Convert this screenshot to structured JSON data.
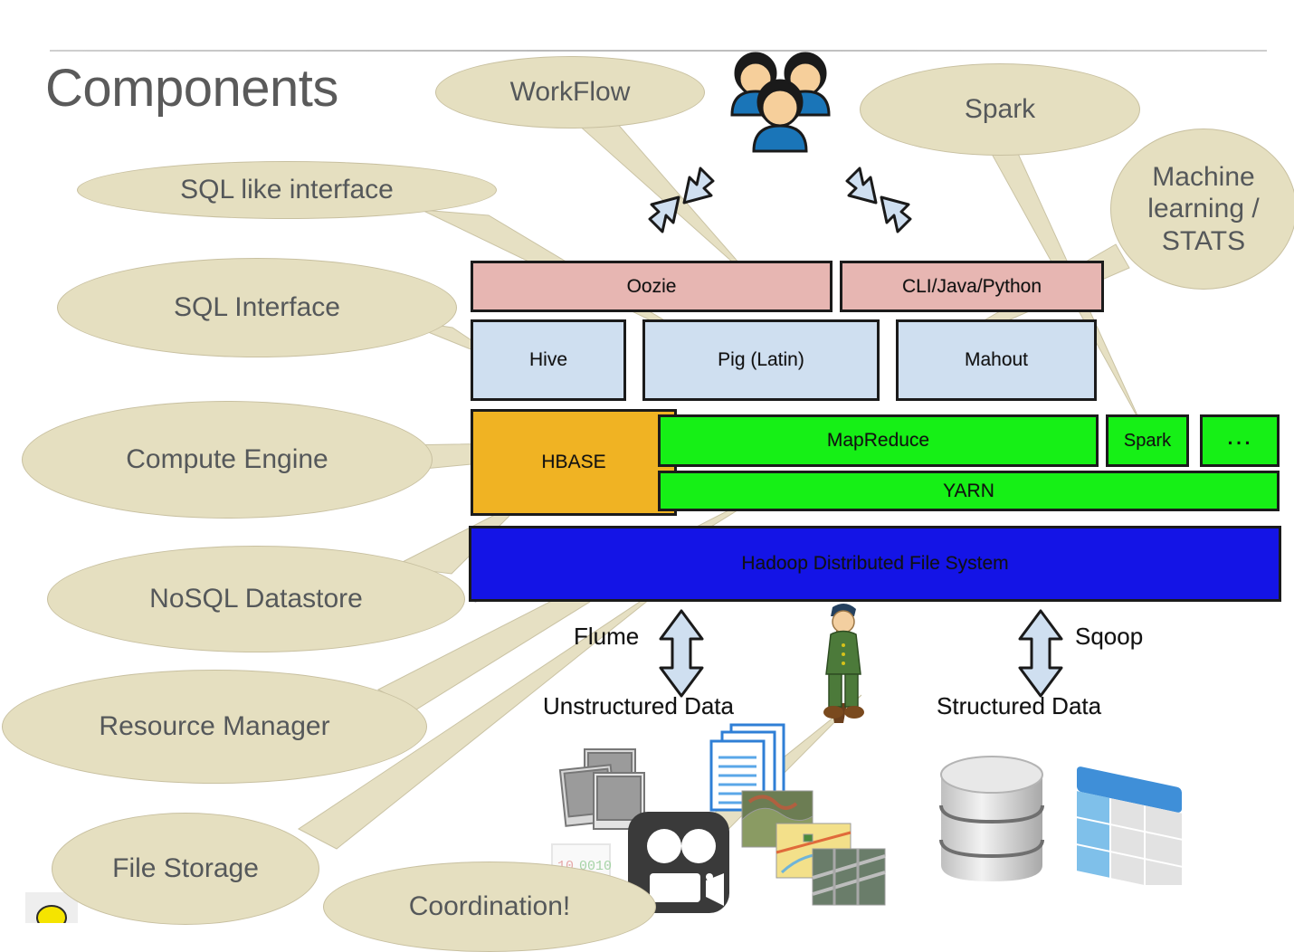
{
  "slide": {
    "title": "Components"
  },
  "callouts": [
    {
      "id": "workflow",
      "label": "WorkFlow"
    },
    {
      "id": "spark",
      "label": "Spark"
    },
    {
      "id": "machine-learning",
      "label": "Machine learning / STATS"
    },
    {
      "id": "sql-like",
      "label": "SQL like interface"
    },
    {
      "id": "sql-interface",
      "label": "SQL Interface"
    },
    {
      "id": "compute-engine",
      "label": "Compute Engine"
    },
    {
      "id": "nosql-datastore",
      "label": "NoSQL Datastore"
    },
    {
      "id": "resource-manager",
      "label": "Resource Manager"
    },
    {
      "id": "file-storage",
      "label": "File Storage"
    },
    {
      "id": "coordination",
      "label": "Coordination!"
    }
  ],
  "architecture": {
    "rows": [
      {
        "name": "interface-row",
        "blocks": [
          {
            "id": "oozie",
            "label": "Oozie",
            "color": "#e7b6b2"
          },
          {
            "id": "cli",
            "label": "CLI/Java/Python",
            "color": "#e7b6b2"
          }
        ]
      },
      {
        "name": "tools-row",
        "blocks": [
          {
            "id": "hive",
            "label": "Hive",
            "color": "#cfdff0"
          },
          {
            "id": "pig",
            "label": "Pig (Latin)",
            "color": "#cfdff0"
          },
          {
            "id": "mahout",
            "label": "Mahout",
            "color": "#cfdff0"
          }
        ]
      },
      {
        "name": "engine-row",
        "blocks": [
          {
            "id": "hbase",
            "label": "HBASE",
            "color": "#f0b323"
          },
          {
            "id": "mapreduce",
            "label": "MapReduce",
            "color": "#16f016"
          },
          {
            "id": "spark-box",
            "label": "Spark",
            "color": "#16f016"
          },
          {
            "id": "more-box",
            "label": "…",
            "color": "#16f016"
          }
        ]
      },
      {
        "name": "resource-row",
        "blocks": [
          {
            "id": "yarn",
            "label": "YARN",
            "color": "#16f016"
          }
        ]
      },
      {
        "name": "storage-row",
        "blocks": [
          {
            "id": "hdfs",
            "label": "Hadoop Distributed File System",
            "color": "#1414e6"
          }
        ]
      }
    ]
  },
  "ingest": {
    "left": {
      "tool": "Flume",
      "data_label": "Unstructured Data"
    },
    "right": {
      "tool": "Sqoop",
      "data_label": "Structured Data"
    }
  },
  "icons": {
    "users": "users-group-icon",
    "arrow_left": "double-arrow-diagonal-icon",
    "arrow_right": "double-arrow-diagonal-icon",
    "flume_arrow": "double-arrow-vertical-icon",
    "sqoop_arrow": "double-arrow-vertical-icon",
    "worker": "hadoop-elephant-worker-icon",
    "photos": "photo-stack-icon",
    "documents": "document-stack-icon",
    "video": "video-camera-icon",
    "maps": "map-imagery-icon",
    "binary": "binary-data-icon",
    "database": "database-cylinder-icon",
    "table": "data-table-icon",
    "corner": "bulb-icon"
  },
  "colors": {
    "bubble": "#e5dfc0",
    "bubble_border": "#c8c0a0",
    "bubble_text": "#55585a",
    "pink": "#e7b6b2",
    "light_blue": "#cfdff0",
    "orange": "#f0b323",
    "green": "#16f016",
    "blue": "#1414e6",
    "title": "#5a5a5a",
    "outline": "#1b1b1b"
  }
}
